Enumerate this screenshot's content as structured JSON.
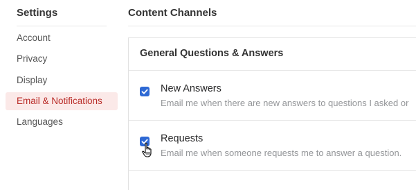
{
  "sidebar": {
    "title": "Settings",
    "items": [
      {
        "label": "Account",
        "active": false
      },
      {
        "label": "Privacy",
        "active": false
      },
      {
        "label": "Display",
        "active": false
      },
      {
        "label": "Email & Notifications",
        "active": true
      },
      {
        "label": "Languages",
        "active": false
      }
    ]
  },
  "main": {
    "title": "Content Channels",
    "section": {
      "header": "General Questions & Answers",
      "options": [
        {
          "label": "New Answers",
          "description": "Email me when there are new answers to questions I asked or",
          "checked": true
        },
        {
          "label": "Requests",
          "description": "Email me when someone requests me to answer a question.",
          "checked": true
        }
      ]
    }
  },
  "colors": {
    "active_bg": "#fbe9e8",
    "active_text": "#b92b27",
    "checkbox": "#2e69d4"
  },
  "icons": {
    "checkmark": "checkmark-icon",
    "cursor": "hand-pointer-cursor-icon"
  }
}
